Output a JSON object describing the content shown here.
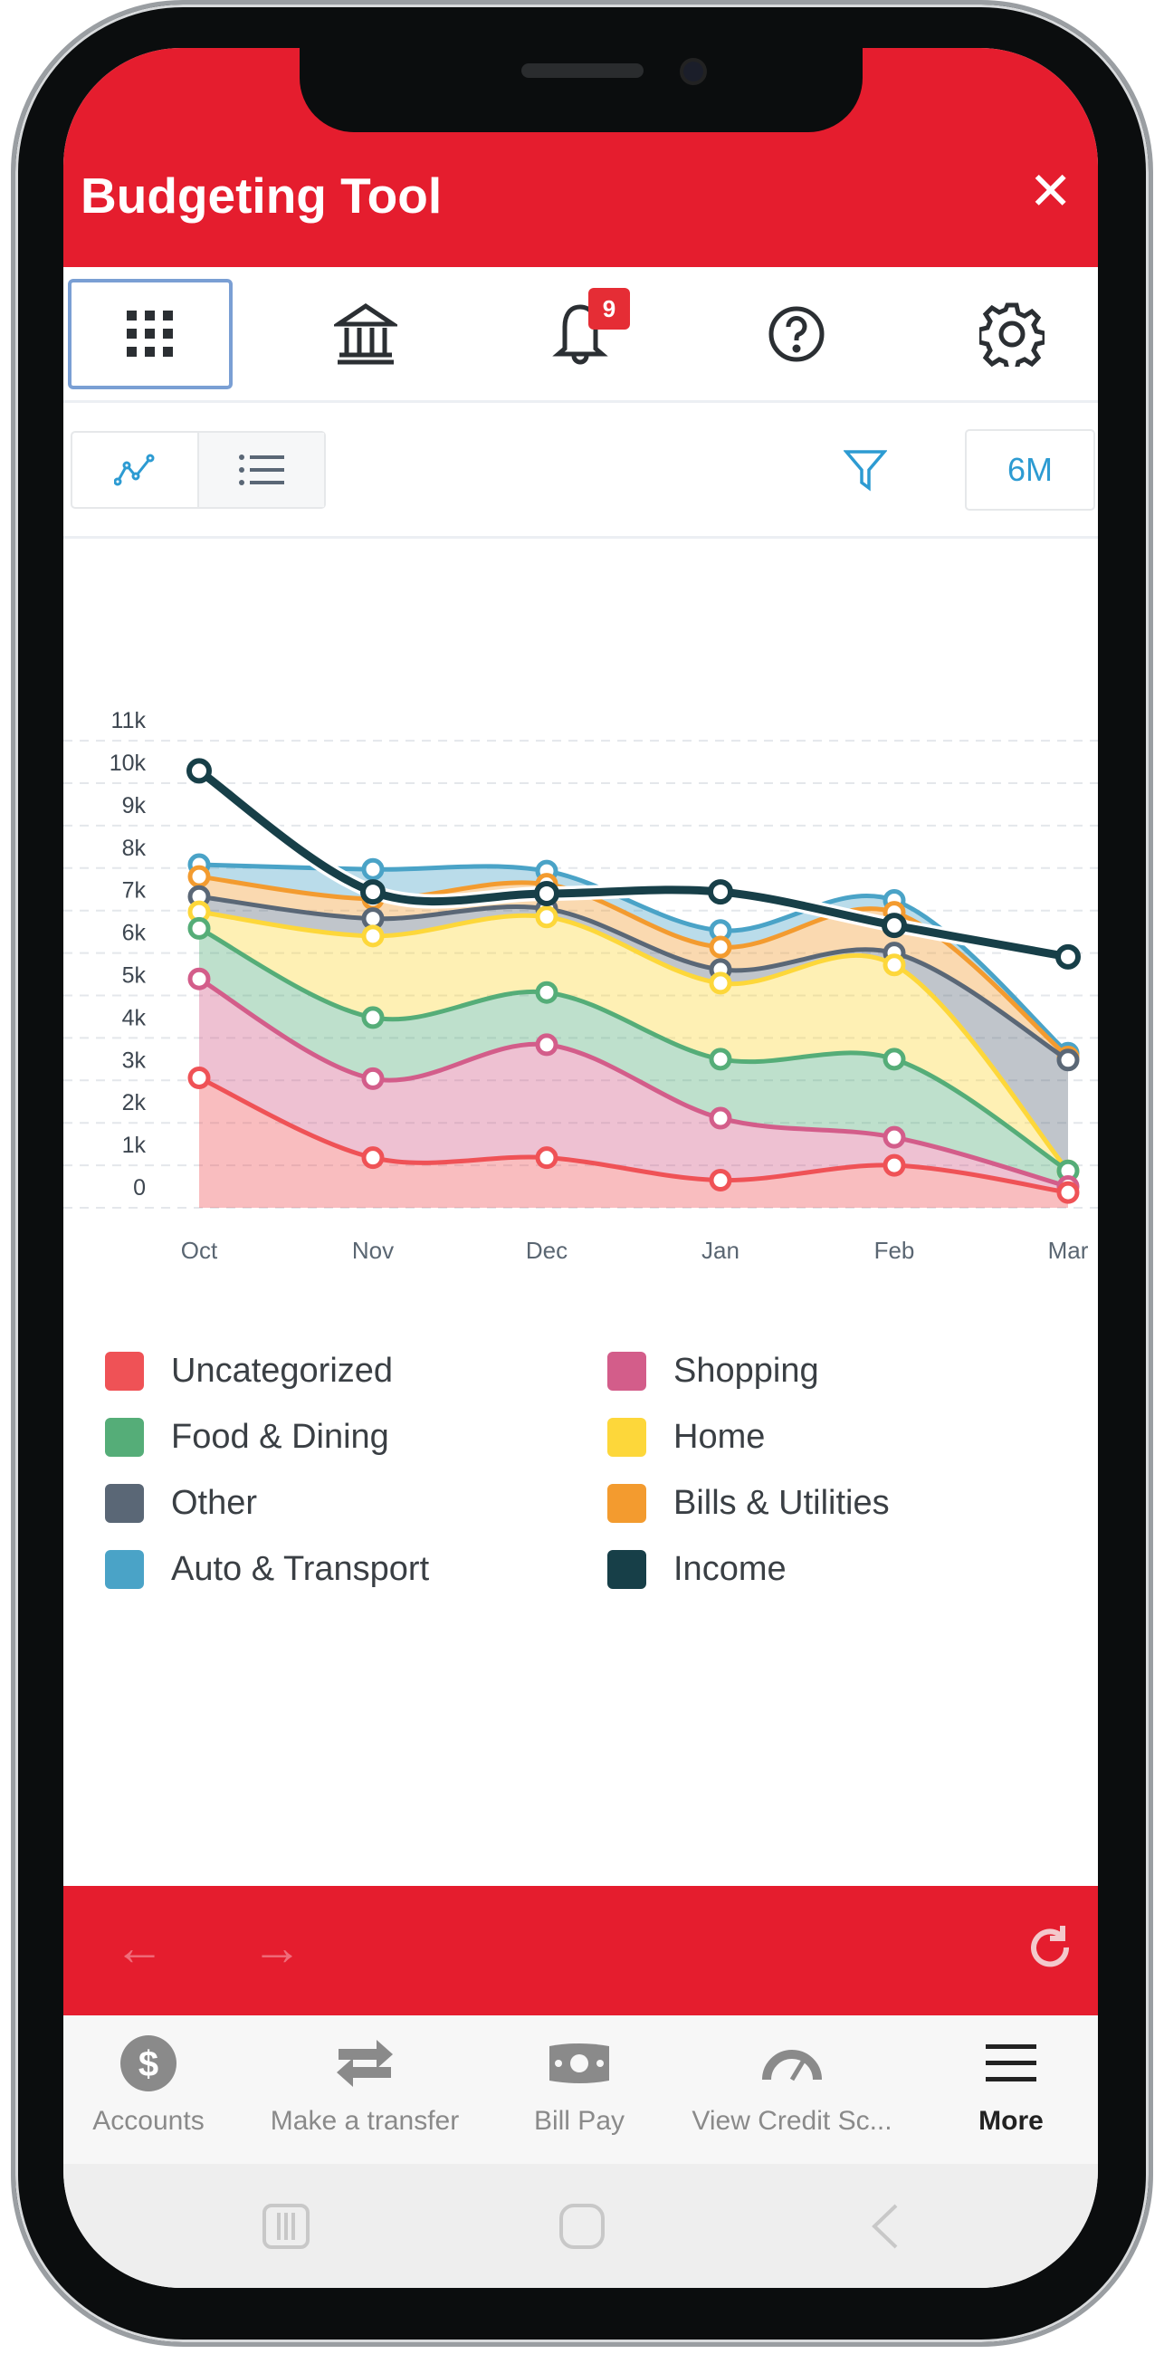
{
  "header": {
    "title": "Budgeting Tool",
    "close_icon": "close-icon"
  },
  "icon_row": {
    "items": [
      {
        "name": "grid-icon",
        "selected": true
      },
      {
        "name": "bank-icon",
        "selected": false
      },
      {
        "name": "bell-icon",
        "selected": false,
        "badge": "9"
      },
      {
        "name": "help-icon",
        "selected": false
      },
      {
        "name": "gear-icon",
        "selected": false
      }
    ]
  },
  "toolbar": {
    "view_chart_icon": "line-chart-icon",
    "view_list_icon": "list-icon",
    "filter_icon": "filter-icon",
    "range": "6M"
  },
  "chart_data": {
    "type": "area",
    "stacked": true,
    "categories": [
      "Oct",
      "Nov",
      "Dec",
      "Jan",
      "Feb",
      "Mar"
    ],
    "y_ticks": [
      "0",
      "1k",
      "2k",
      "3k",
      "4k",
      "5k",
      "6k",
      "7k",
      "8k",
      "9k",
      "10k",
      "11k"
    ],
    "ylim": [
      0,
      11000
    ],
    "grid": true,
    "legend_position": "bottom",
    "series": [
      {
        "name": "Uncategorized",
        "color": "#ef5256",
        "values": [
          3060,
          1180,
          1180,
          650,
          1000,
          360
        ]
      },
      {
        "name": "Shopping",
        "color": "#d35d8a",
        "values": [
          2330,
          1860,
          2660,
          1460,
          660,
          140
        ]
      },
      {
        "name": "Food & Dining",
        "color": "#55ad78",
        "values": [
          1190,
          1440,
          1230,
          1390,
          1840,
          370
        ]
      },
      {
        "name": "Home",
        "color": "#fdd73a",
        "values": [
          390,
          1920,
          1780,
          1790,
          2220,
          0
        ]
      },
      {
        "name": "Other",
        "color": "#5a6776",
        "values": [
          360,
          410,
          190,
          320,
          280,
          2610
        ]
      },
      {
        "name": "Bills & Utilities",
        "color": "#f39b2f",
        "values": [
          470,
          460,
          580,
          530,
          960,
          70
        ]
      },
      {
        "name": "Auto & Transport",
        "color": "#4aa3c7",
        "values": [
          280,
          700,
          310,
          390,
          280,
          90
        ]
      }
    ],
    "line_series": {
      "name": "Income",
      "color": "#173f48",
      "values": [
        10290,
        7440,
        7400,
        7440,
        6650,
        5910
      ]
    }
  },
  "legend": {
    "items": [
      {
        "label": "Uncategorized",
        "color": "#ef5256"
      },
      {
        "label": "Shopping",
        "color": "#d35d8a"
      },
      {
        "label": "Food & Dining",
        "color": "#55ad78"
      },
      {
        "label": "Home",
        "color": "#fdd73a"
      },
      {
        "label": "Other",
        "color": "#5a6776"
      },
      {
        "label": "Bills & Utilities",
        "color": "#f39b2f"
      },
      {
        "label": "Auto & Transport",
        "color": "#4aa3c7"
      },
      {
        "label": "Income",
        "color": "#173f48"
      }
    ]
  },
  "browser_bar": {
    "back_icon": "arrow-left-icon",
    "forward_icon": "arrow-right-icon",
    "refresh_icon": "refresh-icon"
  },
  "tabs": [
    {
      "label": "Accounts",
      "icon": "dollar-icon"
    },
    {
      "label": "Make a transfer",
      "icon": "transfer-icon"
    },
    {
      "label": "Bill Pay",
      "icon": "bill-icon"
    },
    {
      "label": "View Credit Sc...",
      "icon": "gauge-icon"
    },
    {
      "label": "More",
      "icon": "menu-icon",
      "active": true
    }
  ],
  "colors": {
    "brand_red": "#e51d2e",
    "accent_blue": "#2d9bd2"
  }
}
